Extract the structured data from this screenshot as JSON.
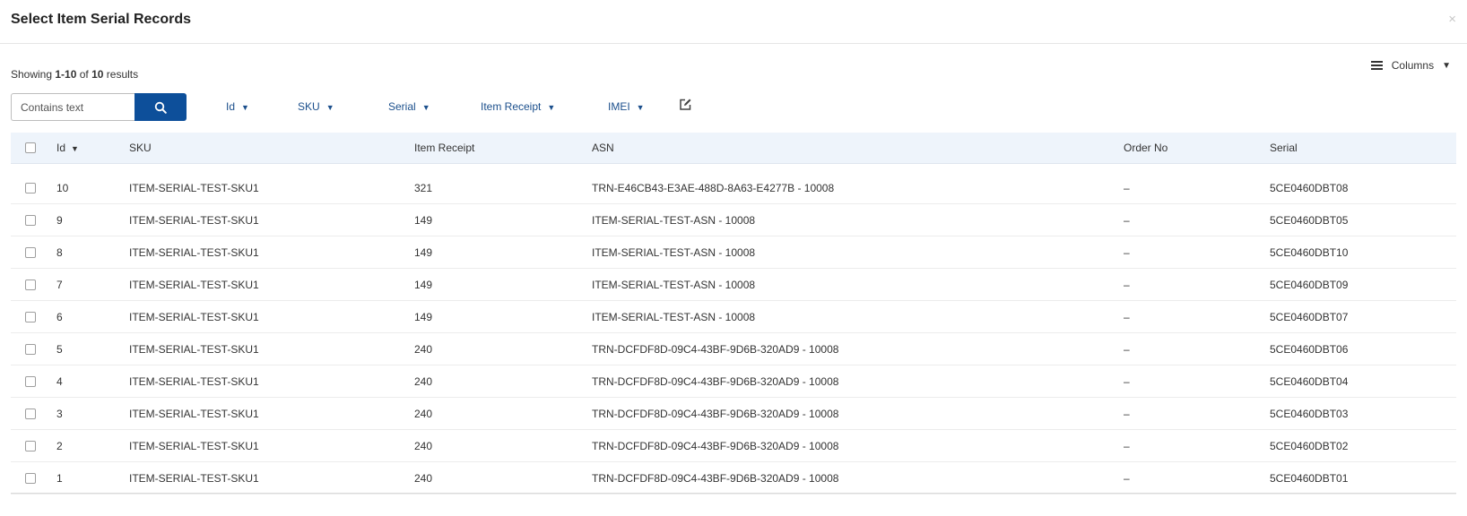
{
  "modal": {
    "title": "Select Item Serial Records",
    "close_label": "×"
  },
  "results": {
    "prefix": "Showing ",
    "range": "1-10",
    "of": " of ",
    "total": "10",
    "suffix": " results"
  },
  "columns_button": {
    "label": "Columns"
  },
  "search": {
    "placeholder": "Contains text"
  },
  "filters": [
    {
      "label": "Id",
      "key": "id"
    },
    {
      "label": "SKU",
      "key": "sku"
    },
    {
      "label": "Serial",
      "key": "serial"
    },
    {
      "label": "Item Receipt",
      "key": "item-receipt"
    },
    {
      "label": "IMEI",
      "key": "imei"
    }
  ],
  "table": {
    "headers": {
      "id": "Id",
      "sku": "SKU",
      "item_receipt": "Item Receipt",
      "asn": "ASN",
      "order_no": "Order No",
      "serial": "Serial"
    },
    "rows": [
      {
        "id": "10",
        "sku": "ITEM-SERIAL-TEST-SKU1",
        "item_receipt": "321",
        "asn": "TRN-E46CB43-E3AE-488D-8A63-E4277B - 10008",
        "order_no": "–",
        "serial": "5CE0460DBT08"
      },
      {
        "id": "9",
        "sku": "ITEM-SERIAL-TEST-SKU1",
        "item_receipt": "149",
        "asn": "ITEM-SERIAL-TEST-ASN - 10008",
        "order_no": "–",
        "serial": "5CE0460DBT05"
      },
      {
        "id": "8",
        "sku": "ITEM-SERIAL-TEST-SKU1",
        "item_receipt": "149",
        "asn": "ITEM-SERIAL-TEST-ASN - 10008",
        "order_no": "–",
        "serial": "5CE0460DBT10"
      },
      {
        "id": "7",
        "sku": "ITEM-SERIAL-TEST-SKU1",
        "item_receipt": "149",
        "asn": "ITEM-SERIAL-TEST-ASN - 10008",
        "order_no": "–",
        "serial": "5CE0460DBT09"
      },
      {
        "id": "6",
        "sku": "ITEM-SERIAL-TEST-SKU1",
        "item_receipt": "149",
        "asn": "ITEM-SERIAL-TEST-ASN - 10008",
        "order_no": "–",
        "serial": "5CE0460DBT07"
      },
      {
        "id": "5",
        "sku": "ITEM-SERIAL-TEST-SKU1",
        "item_receipt": "240",
        "asn": "TRN-DCFDF8D-09C4-43BF-9D6B-320AD9 - 10008",
        "order_no": "–",
        "serial": "5CE0460DBT06"
      },
      {
        "id": "4",
        "sku": "ITEM-SERIAL-TEST-SKU1",
        "item_receipt": "240",
        "asn": "TRN-DCFDF8D-09C4-43BF-9D6B-320AD9 - 10008",
        "order_no": "–",
        "serial": "5CE0460DBT04"
      },
      {
        "id": "3",
        "sku": "ITEM-SERIAL-TEST-SKU1",
        "item_receipt": "240",
        "asn": "TRN-DCFDF8D-09C4-43BF-9D6B-320AD9 - 10008",
        "order_no": "–",
        "serial": "5CE0460DBT03"
      },
      {
        "id": "2",
        "sku": "ITEM-SERIAL-TEST-SKU1",
        "item_receipt": "240",
        "asn": "TRN-DCFDF8D-09C4-43BF-9D6B-320AD9 - 10008",
        "order_no": "–",
        "serial": "5CE0460DBT02"
      },
      {
        "id": "1",
        "sku": "ITEM-SERIAL-TEST-SKU1",
        "item_receipt": "240",
        "asn": "TRN-DCFDF8D-09C4-43BF-9D6B-320AD9 - 10008",
        "order_no": "–",
        "serial": "5CE0460DBT01"
      }
    ]
  },
  "colors": {
    "primary": "#0d4f9a",
    "link": "#1b4f8c",
    "header_bg": "#eef4fb"
  }
}
